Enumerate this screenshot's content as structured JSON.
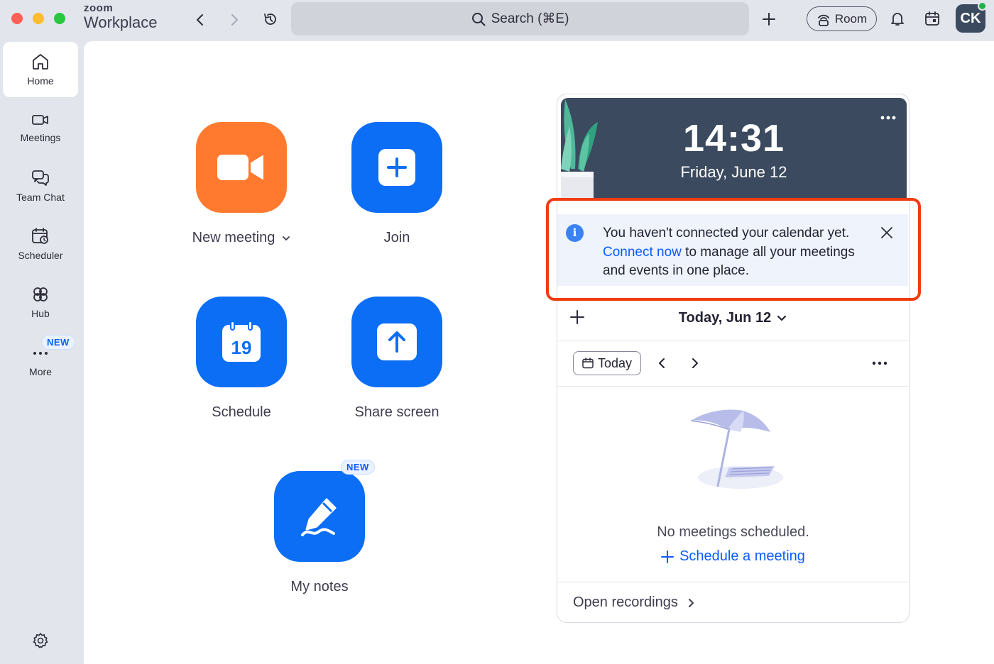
{
  "app": {
    "brand_top": "zoom",
    "brand_bottom": "Workplace"
  },
  "titlebar": {
    "search_label": "Search (⌘E)",
    "room_label": "Room",
    "avatar_initials": "CK"
  },
  "sidebar": {
    "items": [
      {
        "label": "Home",
        "icon": "home-icon",
        "active": true
      },
      {
        "label": "Meetings",
        "icon": "video-icon"
      },
      {
        "label": "Team Chat",
        "icon": "chat-icon"
      },
      {
        "label": "Scheduler",
        "icon": "scheduler-icon"
      },
      {
        "label": "Hub",
        "icon": "hub-icon"
      },
      {
        "label": "More",
        "icon": "more-icon"
      }
    ],
    "new_badge": "NEW"
  },
  "actions": {
    "new_meeting": "New meeting",
    "join": "Join",
    "schedule": "Schedule",
    "schedule_day": "19",
    "share_screen": "Share screen",
    "my_notes": "My notes",
    "notes_badge": "NEW"
  },
  "calendar": {
    "time": "14:31",
    "date": "Friday, June 12",
    "notice": {
      "before": "You haven't connected your calendar yet. ",
      "link": "Connect now",
      "after": " to manage all your meetings and events in one place."
    },
    "day_label": "Today, Jun 12",
    "today_button": "Today",
    "empty_text": "No meetings scheduled.",
    "schedule_link": "Schedule a meeting",
    "footer": "Open recordings"
  },
  "colors": {
    "accent_blue": "#0b6ef5",
    "accent_orange": "#ff7a2e",
    "highlight_red": "#f03c10",
    "hero_slate": "#3b4a5e"
  }
}
